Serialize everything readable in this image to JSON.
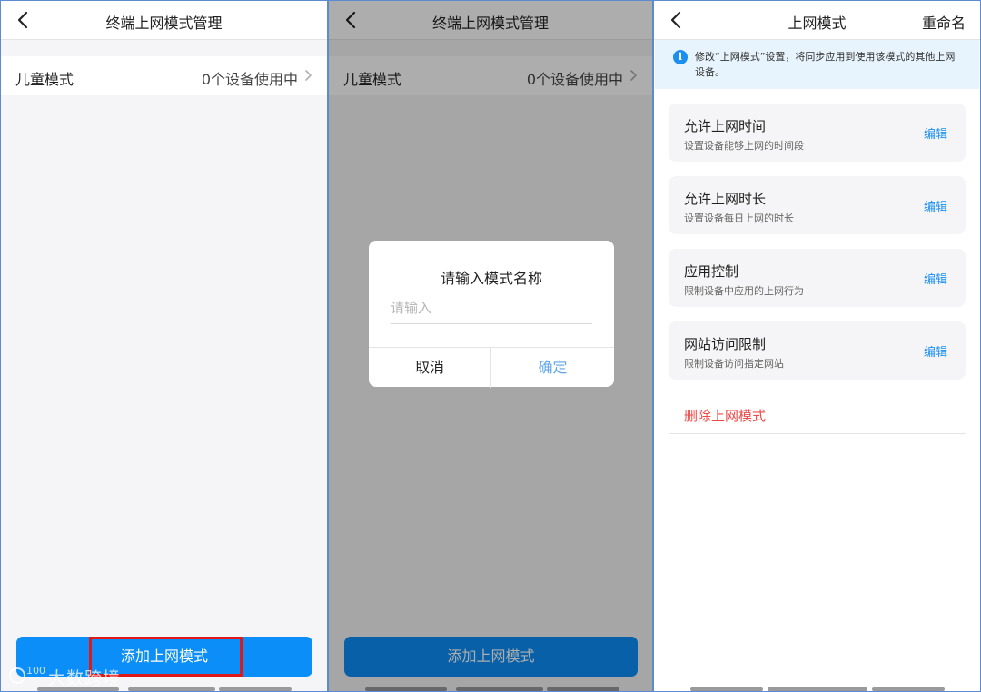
{
  "screen1": {
    "title": "终端上网模式管理",
    "mode_row": {
      "label": "儿童模式",
      "value": "0个设备使用中"
    },
    "add_button_label": "添加上网模式"
  },
  "screen2": {
    "title": "终端上网模式管理",
    "mode_row": {
      "label": "儿童模式",
      "value": "0个设备使用中"
    },
    "add_button_label": "添加上网模式",
    "dialog": {
      "title": "请输入模式名称",
      "input_value": "",
      "input_placeholder": "请输入",
      "cancel_label": "取消",
      "confirm_label": "确定"
    }
  },
  "screen3": {
    "title": "上网模式",
    "rename_label": "重命名",
    "notice_text": "修改“上网模式”设置，将同步应用到使用该模式的其他上网设备。",
    "cards": [
      {
        "title": "允许上网时间",
        "desc": "设置设备能够上网的时间段",
        "action": "编辑"
      },
      {
        "title": "允许上网时长",
        "desc": "设置设备每日上网的时长",
        "action": "编辑"
      },
      {
        "title": "应用控制",
        "desc": "限制设备中应用的上网行为",
        "action": "编辑"
      },
      {
        "title": "网站访问限制",
        "desc": "限制设备访问指定网站",
        "action": "编辑"
      }
    ],
    "delete_label": "删除上网模式"
  },
  "watermark_text": "大数跨境",
  "colors": {
    "primary": "#0b8ef8",
    "link": "#1a8ff0",
    "danger": "#f04a4a",
    "highlight": "#e01818",
    "notice_bg": "#e8f4fd"
  },
  "icons": {
    "back": "chevron-left-icon",
    "chevron": "chevron-right-icon",
    "info": "info-icon"
  }
}
